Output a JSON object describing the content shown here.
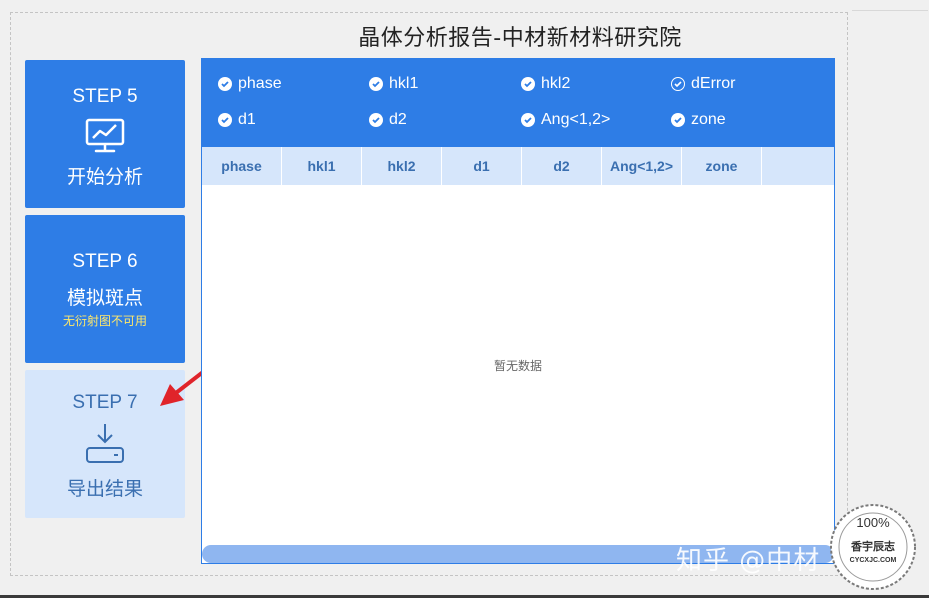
{
  "title": "晶体分析报告-中材新材料研究院",
  "steps": [
    {
      "num": "STEP 5",
      "label": "开始分析",
      "icon": "monitor-chart-icon"
    },
    {
      "num": "STEP 6",
      "label": "模拟斑点",
      "note": "无衍射图不可用"
    },
    {
      "num": "STEP 7",
      "label": "导出结果",
      "icon": "download-tray-icon"
    }
  ],
  "column_toggles": [
    {
      "label": "phase",
      "checked": true
    },
    {
      "label": "hkl1",
      "checked": true
    },
    {
      "label": "hkl2",
      "checked": true
    },
    {
      "label": "dError",
      "checked": false
    },
    {
      "label": "d1",
      "checked": true
    },
    {
      "label": "d2",
      "checked": true
    },
    {
      "label": "Ang<1,2>",
      "checked": true
    },
    {
      "label": "zone",
      "checked": true
    }
  ],
  "table": {
    "headers": [
      "phase",
      "hkl1",
      "hkl2",
      "d1",
      "d2",
      "Ang<1,2>",
      "zone"
    ],
    "empty_text": "暂无数据"
  },
  "watermark": "知乎 @中材",
  "seal": {
    "top": "100%",
    "middle": "香宇辰志",
    "bottom": "CYCXJC.COM"
  },
  "colors": {
    "accent": "#2e7de6",
    "light": "#d6e6fb",
    "note": "#ffe86a",
    "arrow": "#e0242a"
  }
}
